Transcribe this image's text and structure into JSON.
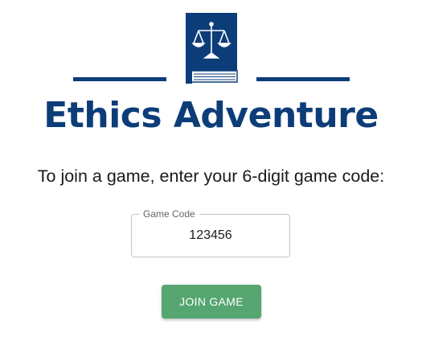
{
  "brand": {
    "title": "Ethics Adventure",
    "logo_icon": "book-with-scales-icon",
    "color": "#0c3d78"
  },
  "join": {
    "instruction": "To join a game, enter your 6-digit game code:",
    "field_label": "Game Code",
    "field_value": "123456",
    "button_label": "JOIN GAME",
    "button_color": "#55a670"
  }
}
